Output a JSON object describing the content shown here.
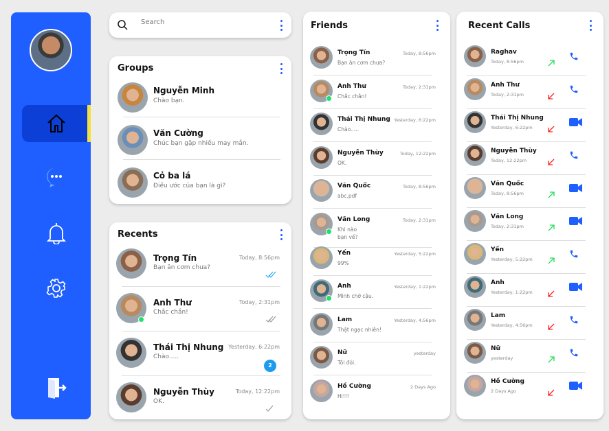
{
  "sidebar": {
    "items": [
      {
        "id": "home",
        "icon": "home-icon",
        "active": true
      },
      {
        "id": "messages",
        "icon": "chat-icon"
      },
      {
        "id": "notifications",
        "icon": "bell-icon"
      },
      {
        "id": "settings",
        "icon": "gear-icon"
      }
    ],
    "logout_icon": "logout-icon",
    "accent": "#1f5eff",
    "active_marker": "#f4e03c"
  },
  "search": {
    "placeholder": "Search"
  },
  "groups": {
    "title": "Groups",
    "items": [
      {
        "name": "Nguyễn Minh",
        "msg": "Chào bạn.",
        "c": "#c9853d"
      },
      {
        "name": "Văn Cường",
        "msg": "Chúc bạn gặp nhiều may mắn.",
        "c": "#6b8fb8"
      },
      {
        "name": "Cỏ ba lá",
        "msg": "Điều ước của bạn là gì?",
        "c": "#8a6d55"
      }
    ]
  },
  "recents": {
    "title": "Recents",
    "items": [
      {
        "name": "Trọng Tín",
        "msg": "Bạn ăn cơm chưa?",
        "time": "Today, 8:56pm",
        "status": "read",
        "c": "#8a6048"
      },
      {
        "name": "Anh Thư",
        "msg": "Chắc chắn!",
        "time": "Today, 2:31pm",
        "status": "delivered",
        "online": true,
        "c": "#b88a60"
      },
      {
        "name": "Thái Thị Nhung",
        "msg": "Chào.....",
        "time": "Yesterday, 6:22pm",
        "unread": "2",
        "c": "#333"
      },
      {
        "name": "Nguyễn Thùy",
        "msg": "OK.",
        "time": "Today, 12:22pm",
        "status": "sent",
        "c": "#5a3d2e"
      }
    ]
  },
  "friends": {
    "title": "Friends",
    "items": [
      {
        "name": "Trọng Tín",
        "msg": "Bạn ăn cơm chưa?",
        "time": "Today, 8:56pm",
        "c": "#8a6048"
      },
      {
        "name": "Anh Thư",
        "msg": "Chắc chắn!",
        "time": "Today, 2:31pm",
        "online": true,
        "c": "#b88a60"
      },
      {
        "name": "Thái Thị Nhung",
        "msg": "Chào.....",
        "time": "Yesterday, 6:22pm",
        "c": "#333"
      },
      {
        "name": "Nguyễn Thùy",
        "msg": "OK.",
        "time": "Today, 12:22pm",
        "c": "#5a3d2e"
      },
      {
        "name": "Văn Quốc",
        "msg": "abc.pdf",
        "time": "Today, 8:56pm",
        "c": "#d9b59a"
      },
      {
        "name": "Văn Long",
        "msg": "Khi nào\nbạn về?",
        "time": "Today, 2:31pm",
        "online": true,
        "c": "#a89a90"
      },
      {
        "name": "Yến",
        "msg": "99%",
        "time": "Yesterday, 5:22pm",
        "c": "#d9b777"
      },
      {
        "name": "Anh",
        "msg": "Mình chờ cậu.",
        "time": "Yesterday, 1:22pm",
        "online": true,
        "c": "#3f6c78"
      },
      {
        "name": "Lam",
        "msg": "Thật ngạc nhiên!",
        "time": "Yesterday, 4:56pm",
        "c": "#777"
      },
      {
        "name": "Nữ",
        "msg": "Tôi đói.",
        "time": "yesterday",
        "c": "#7a5a45"
      },
      {
        "name": "Hồ Cường",
        "msg": "Hi!!!",
        "time": "2 Days Ago",
        "c": "#c7a6a0"
      }
    ]
  },
  "calls": {
    "title": "Recent Calls",
    "outgoing_color": "#22dd55",
    "missed_color": "#ff2222",
    "items": [
      {
        "name": "Raghav",
        "time": "Today, 8:56pm",
        "dir": "out",
        "type": "voice",
        "c": "#8a6048"
      },
      {
        "name": "Anh Thư",
        "time": "Today, 2:31pm",
        "dir": "in",
        "type": "voice",
        "c": "#b88a60"
      },
      {
        "name": "Thái Thị Nhung",
        "time": "Yesterday, 6:22pm",
        "dir": "in",
        "type": "video",
        "c": "#333"
      },
      {
        "name": "Nguyễn Thùy",
        "time": "Today, 12:22pm",
        "dir": "in",
        "type": "voice",
        "c": "#5a3d2e"
      },
      {
        "name": "Văn Quốc",
        "time": "Today, 8:56pm",
        "dir": "out",
        "type": "video",
        "c": "#d9b59a"
      },
      {
        "name": "Văn Long",
        "time": "Today, 2:31pm",
        "dir": "out",
        "type": "video",
        "c": "#a89a90"
      },
      {
        "name": "Yến",
        "time": "Yesterday, 5:22pm",
        "dir": "out",
        "type": "voice",
        "c": "#d9b777"
      },
      {
        "name": "Anh",
        "time": "Yesterday, 1:22pm",
        "dir": "in",
        "type": "video",
        "c": "#3f6c78"
      },
      {
        "name": "Lam",
        "time": "Yesterday, 4:56pm",
        "dir": "in",
        "type": "voice",
        "c": "#777"
      },
      {
        "name": "Nữ",
        "time": "yesterday",
        "dir": "out",
        "type": "voice",
        "c": "#7a5a45"
      },
      {
        "name": "Hồ Cường",
        "time": "2 Days Ago",
        "dir": "in",
        "type": "video",
        "c": "#c7a6a0"
      }
    ]
  }
}
